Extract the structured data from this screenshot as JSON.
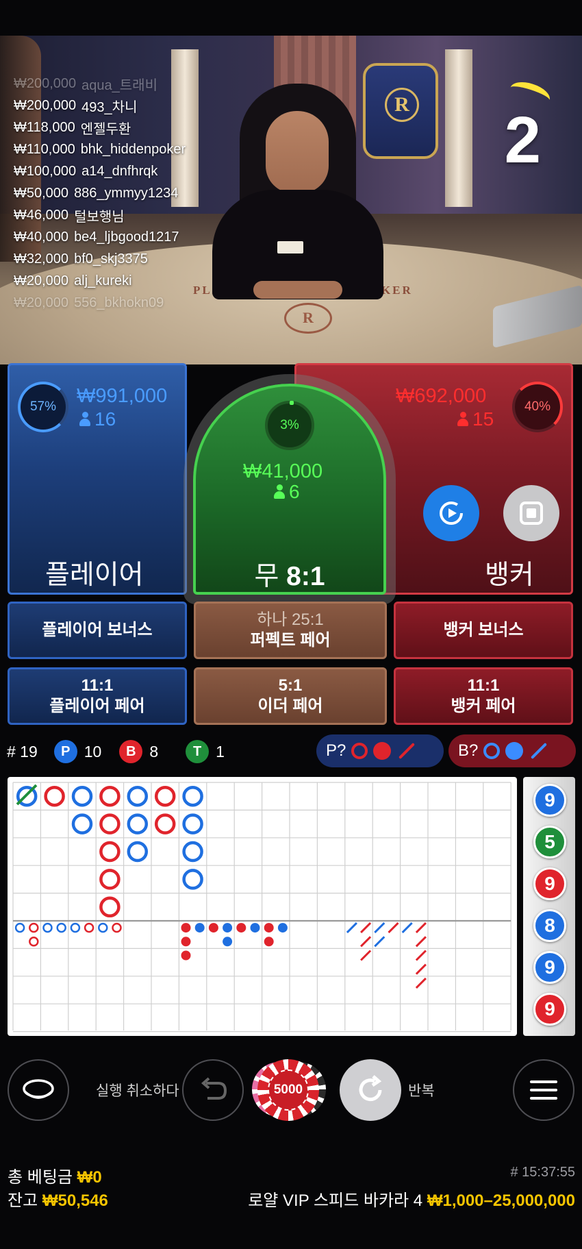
{
  "video": {
    "countdown": "2",
    "table_labels": {
      "player": "PLAYER",
      "banker": "BANKER"
    },
    "winners": [
      {
        "amount": "₩200,000",
        "name": "aqua_트래비"
      },
      {
        "amount": "₩200,000",
        "name": "493_차니"
      },
      {
        "amount": "₩118,000",
        "name": "엔젤두환"
      },
      {
        "amount": "₩110,000",
        "name": "bhk_hiddenpoker"
      },
      {
        "amount": "₩100,000",
        "name": "a14_dnfhrqk"
      },
      {
        "amount": "₩50,000",
        "name": "886_ymmyy1234"
      },
      {
        "amount": "₩46,000",
        "name": "털보행님"
      },
      {
        "amount": "₩40,000",
        "name": "be4_ljbgood1217"
      },
      {
        "amount": "₩32,000",
        "name": "bf0_skj3375"
      },
      {
        "amount": "₩20,000",
        "name": "alj_kureki"
      },
      {
        "amount": "₩20,000",
        "name": "556_bkhokn09"
      }
    ]
  },
  "bets": {
    "player": {
      "label": "플레이어",
      "percent": "57%",
      "amount": "₩991,000",
      "count": "16",
      "color": "#4a9cff"
    },
    "tie": {
      "label": "무",
      "payout": "8:1",
      "percent": "3%",
      "amount": "₩41,000",
      "count": "6",
      "color": "#58ff58"
    },
    "banker": {
      "label": "뱅커",
      "percent": "40%",
      "amount": "₩692,000",
      "count": "15",
      "color": "#ff2e2e"
    }
  },
  "side_bets": {
    "player_bonus": "플레이어 보너스",
    "perfect_pair_sub": "하나 25:1",
    "perfect_pair": "퍼펙트 페어",
    "banker_bonus": "뱅커 보너스",
    "player_pair_odds": "11:1",
    "player_pair": "플레이어 페어",
    "either_pair_odds": "5:1",
    "either_pair": "이더 페어",
    "banker_pair_odds": "11:1",
    "banker_pair": "뱅커 페어"
  },
  "stats": {
    "round": "# 19",
    "p_letter": "P",
    "p_count": "10",
    "b_letter": "B",
    "b_count": "8",
    "t_letter": "T",
    "t_count": "1",
    "p_predict": "P?",
    "b_predict": "B?"
  },
  "side_road": [
    "9",
    "5",
    "9",
    "8",
    "9",
    "9"
  ],
  "controls": {
    "undo_label": "실행 취소하다",
    "chip_value": "5000",
    "repeat_label": "반복"
  },
  "footer": {
    "total_bet_label": "총 베팅금",
    "total_bet": "₩0",
    "balance_label": "잔고",
    "balance": "₩50,546",
    "round_time": "# 15:37:55",
    "table_name": "로얄 VIP 스피드 바카라 4",
    "limits": "₩1,000–25,000,000"
  },
  "colors": {
    "player": "#1f6fe0",
    "banker": "#e0242c",
    "tie": "#1f8f3b",
    "gold": "#f5c400"
  }
}
